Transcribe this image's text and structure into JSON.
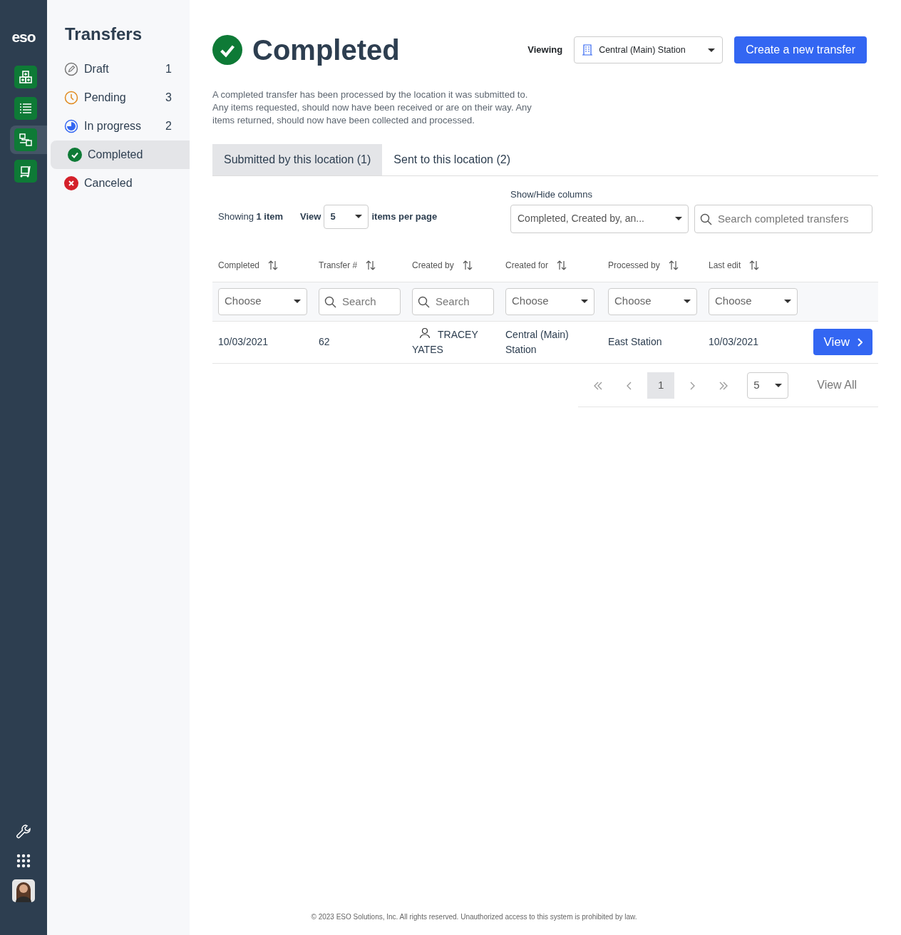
{
  "rail": {
    "logo": "eso",
    "items": [
      {
        "kind": "boxes",
        "selected": false
      },
      {
        "kind": "list",
        "selected": false
      },
      {
        "kind": "transfer",
        "selected": true
      },
      {
        "kind": "cart",
        "selected": false
      }
    ],
    "bottom": [
      {
        "kind": "wrench"
      },
      {
        "kind": "apps"
      }
    ]
  },
  "sidebar": {
    "title": "Transfers",
    "items": [
      {
        "label": "Draft",
        "count": "1",
        "kind": "draft",
        "selected": false
      },
      {
        "label": "Pending",
        "count": "3",
        "kind": "pending",
        "selected": false
      },
      {
        "label": "In progress",
        "count": "2",
        "kind": "progress",
        "selected": false
      },
      {
        "label": "Completed",
        "kind": "completed",
        "selected": true
      },
      {
        "label": "Canceled",
        "kind": "canceled",
        "selected": false
      }
    ]
  },
  "header": {
    "title": "Completed",
    "viewing_label": "Viewing",
    "location": "Central (Main) Station",
    "create_button": "Create a new transfer"
  },
  "description": "A completed transfer has been processed by the location it was submitted to. Any items requested, should now have been received or are on their way. Any items returned, should now have been collected and processed.",
  "tabs": [
    {
      "label": "Submitted by this location (1)",
      "selected": true
    },
    {
      "label": "Sent to this location (2)",
      "selected": false
    }
  ],
  "toolbar": {
    "showing": "Showing **1 item**",
    "view_label": "View",
    "per_page": "5",
    "per_page_suffix": "items per page",
    "columns_label": "Show/Hide columns",
    "columns_value": "Completed, Created by, an...",
    "search_placeholder": "Search completed transfers"
  },
  "table": {
    "columns": [
      {
        "label": "Completed",
        "filter": {
          "kind": "select",
          "text": "Choose"
        }
      },
      {
        "label": "Transfer #",
        "filter": {
          "kind": "search",
          "placeholder": "Search"
        }
      },
      {
        "label": "Created by",
        "filter": {
          "kind": "search",
          "placeholder": "Search"
        }
      },
      {
        "label": "Created for",
        "filter": {
          "kind": "select",
          "text": "Choose"
        }
      },
      {
        "label": "Processed by",
        "filter": {
          "kind": "select",
          "text": "Choose"
        }
      },
      {
        "label": "Last edit",
        "filter": {
          "kind": "select",
          "text": "Choose"
        }
      }
    ],
    "rows": [
      {
        "cells": [
          {
            "text": "10/03/2021"
          },
          {
            "text": "62"
          },
          {
            "text": "TRACEY YATES",
            "kind": "person"
          },
          {
            "text": "Central (Main) Station"
          },
          {
            "text": "East Station"
          },
          {
            "text": "10/03/2021"
          }
        ],
        "action": "View"
      }
    ]
  },
  "pagination": {
    "pages": [
      {
        "label": "1",
        "selected": true
      }
    ],
    "page_size": "5",
    "view_all": "View All"
  },
  "footer": "© 2023 ESO Solutions, Inc. All rights reserved. Unauthorized access to this system is prohibited by law."
}
